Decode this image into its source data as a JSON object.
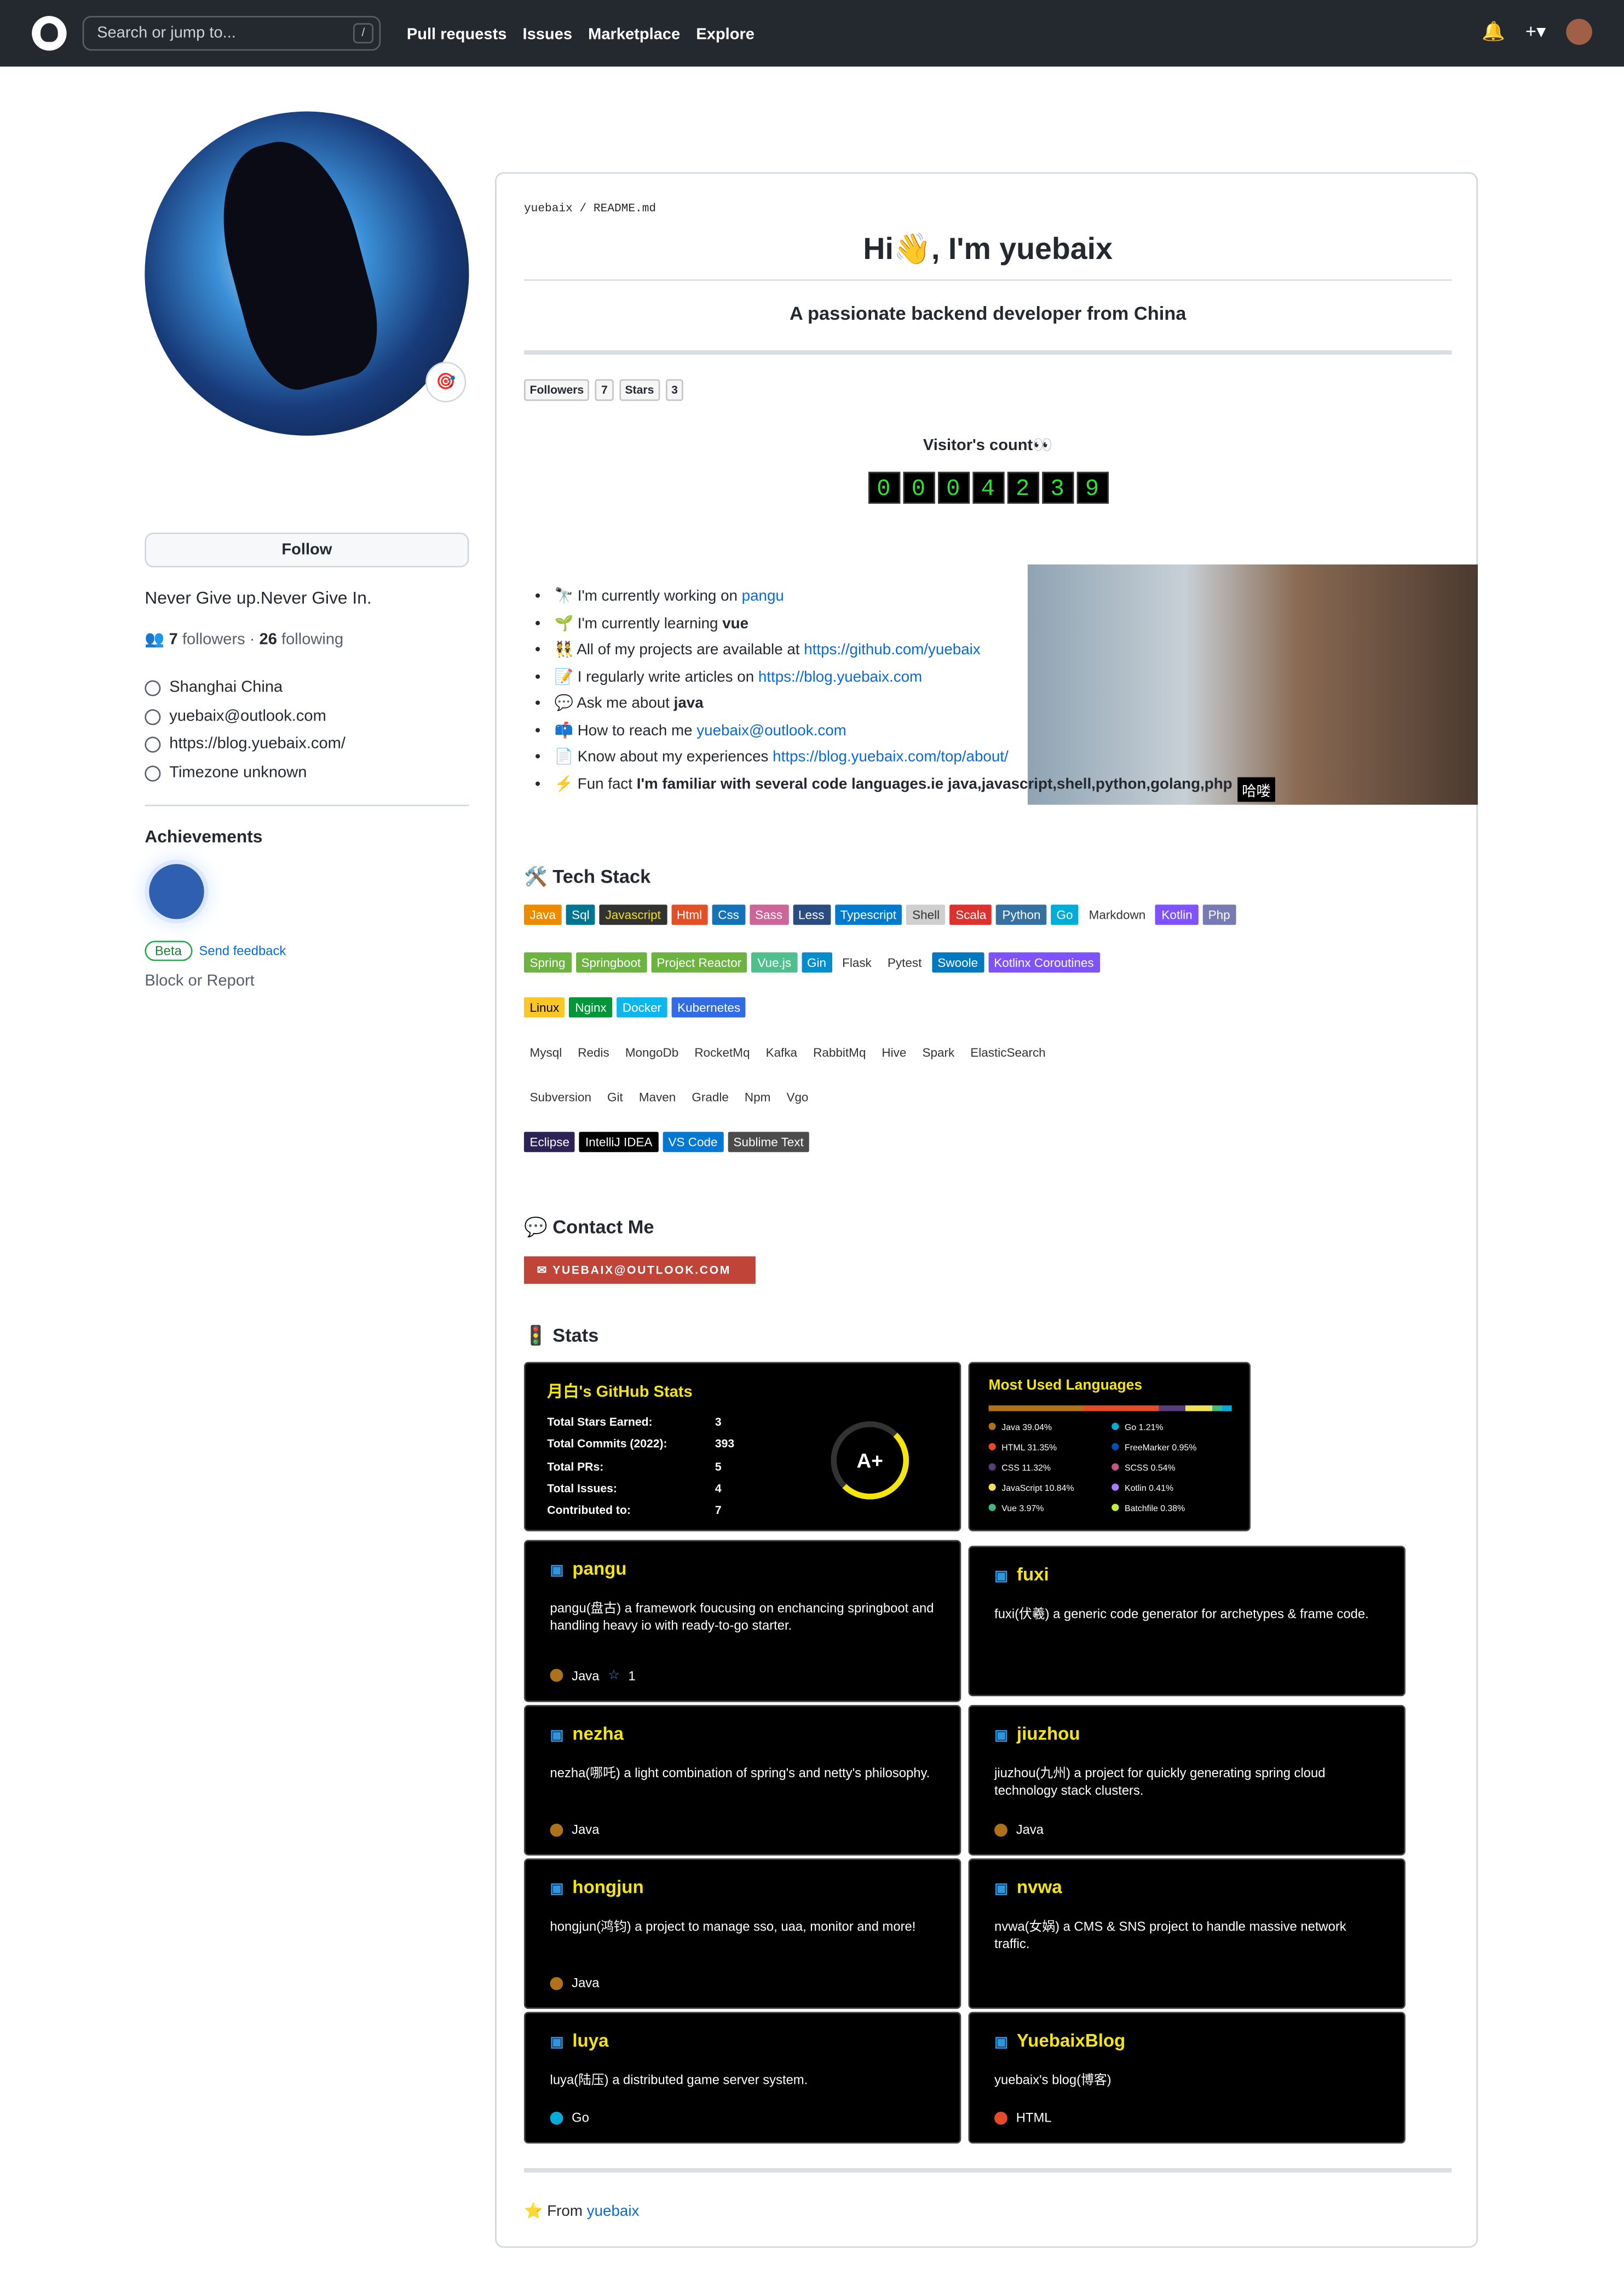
{
  "header": {
    "search_placeholder": "Search or jump to...",
    "slash": "/",
    "nav": [
      "Pull requests",
      "Issues",
      "Marketplace",
      "Explore"
    ]
  },
  "profile": {
    "follow": "Follow",
    "bio": "Never Give up.Never Give In.",
    "followers": "7",
    "followers_label": "followers",
    "following": "26",
    "following_label": "following",
    "location": "Shanghai China",
    "email": "yuebaix@outlook.com",
    "website": "https://blog.yuebaix.com/",
    "timezone": "Timezone unknown",
    "achievements": "Achievements",
    "beta": "Beta",
    "feedback": "Send feedback",
    "block": "Block or Report"
  },
  "readme": {
    "path_user": "yuebaix",
    "path_file": "README.md",
    "title": "Hi👋, I'm yuebaix",
    "subtitle": "A passionate backend developer from China",
    "followers": "Followers",
    "followers_count": "7",
    "stars": "Stars",
    "stars_count": "3",
    "visitor": "Visitor's count👀",
    "digits": [
      "0",
      "0",
      "0",
      "4",
      "2",
      "3",
      "9"
    ],
    "gif_caption": "哈喽",
    "facts": [
      {
        "pre": "🔭 I'm currently working on ",
        "link": "pangu"
      },
      {
        "pre": "🌱 I'm currently learning ",
        "bold": "vue"
      },
      {
        "pre": "👯 All of my projects are available at ",
        "link": "https://github.com/yuebaix"
      },
      {
        "pre": "📝 I regularly write articles on ",
        "link": "https://blog.yuebaix.com"
      },
      {
        "pre": "💬 Ask me about ",
        "bold": "java"
      },
      {
        "pre": "📫 How to reach me ",
        "link": "yuebaix@outlook.com"
      },
      {
        "pre": "📄 Know about my experiences ",
        "link": "https://blog.yuebaix.com/top/about/"
      },
      {
        "pre": "⚡ Fun fact ",
        "bold": "I'm familiar with several code languages.ie java,javascript,shell,python,golang,php"
      }
    ],
    "tech_title": "🛠️ Tech Stack",
    "rows": [
      [
        {
          "t": "Java",
          "c": "#ed8b00"
        },
        {
          "t": "Sql",
          "c": "#00758f"
        },
        {
          "t": "Javascript",
          "c": "#323330",
          "f": "#f7df1e"
        },
        {
          "t": "Html",
          "c": "#e34f26"
        },
        {
          "t": "Css",
          "c": "#1572b6"
        },
        {
          "t": "Sass",
          "c": "#cc6699"
        },
        {
          "t": "Less",
          "c": "#2b4c80"
        },
        {
          "t": "Typescript",
          "c": "#007acc"
        },
        {
          "t": "Shell",
          "c": "#cfcfcf",
          "f": "#333"
        },
        {
          "t": "Scala",
          "c": "#dc322f"
        },
        {
          "t": "Python",
          "c": "#3670a0"
        },
        {
          "t": "Go",
          "c": "#00add8"
        },
        {
          "t": "Markdown",
          "c": ""
        },
        {
          "t": "Kotlin",
          "c": "#7f52ff"
        },
        {
          "t": "Php",
          "c": "#777bb4"
        }
      ],
      [
        {
          "t": "Spring",
          "c": "#6db33f"
        },
        {
          "t": "Springboot",
          "c": "#6db33f"
        },
        {
          "t": "Project Reactor",
          "c": "#6db33f"
        },
        {
          "t": "Vue.js",
          "c": "#4fc08d"
        },
        {
          "t": "Gin",
          "c": "#008ecf"
        },
        {
          "t": "Flask",
          "c": ""
        },
        {
          "t": "Pytest",
          "c": ""
        },
        {
          "t": "Swoole",
          "c": "#0079c1"
        },
        {
          "t": "Kotlinx Coroutines",
          "c": "#7f52ff"
        }
      ],
      [
        {
          "t": "Linux",
          "c": "#fcc624",
          "f": "#000"
        },
        {
          "t": "Nginx",
          "c": "#009639"
        },
        {
          "t": "Docker",
          "c": "#0db7ed"
        },
        {
          "t": "Kubernetes",
          "c": "#326ce5"
        }
      ],
      [
        {
          "t": "Mysql",
          "c": ""
        },
        {
          "t": "Redis",
          "c": ""
        },
        {
          "t": "MongoDb",
          "c": ""
        },
        {
          "t": "RocketMq",
          "c": ""
        },
        {
          "t": "Kafka",
          "c": ""
        },
        {
          "t": "RabbitMq",
          "c": ""
        },
        {
          "t": "Hive",
          "c": ""
        },
        {
          "t": "Spark",
          "c": ""
        },
        {
          "t": "ElasticSearch",
          "c": ""
        }
      ],
      [
        {
          "t": "Subversion",
          "c": ""
        },
        {
          "t": "Git",
          "c": ""
        },
        {
          "t": "Maven",
          "c": ""
        },
        {
          "t": "Gradle",
          "c": ""
        },
        {
          "t": "Npm",
          "c": ""
        },
        {
          "t": "Vgo",
          "c": ""
        }
      ],
      [
        {
          "t": "Eclipse",
          "c": "#2c2255"
        },
        {
          "t": "IntelliJ IDEA",
          "c": "#000"
        },
        {
          "t": "VS Code",
          "c": "#0078d4"
        },
        {
          "t": "Sublime Text",
          "c": "#4c4c4c"
        }
      ]
    ],
    "contact_title": "💬 Contact Me",
    "mail_badge": "✉ YUEBAIX@OUTLOOK.COM",
    "stats_title": "🚦 Stats",
    "gh": {
      "title": "月白's GitHub Stats",
      "rows": [
        [
          "Total Stars Earned:",
          "3"
        ],
        [
          "Total Commits (2022):",
          "393"
        ],
        [
          "Total PRs:",
          "5"
        ],
        [
          "Total Issues:",
          "4"
        ],
        [
          "Contributed to:",
          "7"
        ]
      ],
      "grade": "A+"
    },
    "langs": {
      "title": "Most Used Languages",
      "items": [
        [
          "Java 39.04%",
          "#b07219"
        ],
        [
          "Go 1.21%",
          "#00add8"
        ],
        [
          "HTML 31.35%",
          "#e34c26"
        ],
        [
          "FreeMarker 0.95%",
          "#0050b2"
        ],
        [
          "CSS 11.32%",
          "#563d7c"
        ],
        [
          "SCSS 0.54%",
          "#c6538c"
        ],
        [
          "JavaScript 10.84%",
          "#f1e05a"
        ],
        [
          "Kotlin 0.41%",
          "#a97bff"
        ],
        [
          "Vue 3.97%",
          "#41b883"
        ],
        [
          "Batchfile 0.38%",
          "#c1f12e"
        ]
      ]
    },
    "repos": [
      {
        "n": "pangu",
        "d": "pangu(盘古) a framework foucusing on enchancing springboot and handling heavy io with ready-to-go starter.",
        "l": "Java",
        "c": "#b07219",
        "s": "1"
      },
      {
        "n": "fuxi",
        "d": "fuxi(伏羲) a generic code generator for archetypes & frame code.",
        "l": "",
        "c": ""
      },
      {
        "n": "nezha",
        "d": "nezha(哪吒) a light combination of spring's and netty's philosophy.",
        "l": "Java",
        "c": "#b07219"
      },
      {
        "n": "jiuzhou",
        "d": "jiuzhou(九州) a project for quickly generating spring cloud technology stack clusters.",
        "l": "Java",
        "c": "#b07219"
      },
      {
        "n": "hongjun",
        "d": "hongjun(鸿钧) a project to manage sso, uaa, monitor and more!",
        "l": "Java",
        "c": "#b07219"
      },
      {
        "n": "nvwa",
        "d": "nvwa(女娲) a CMS & SNS project to handle massive network traffic.",
        "l": "",
        "c": ""
      },
      {
        "n": "luya",
        "d": "luya(陆压) a distributed game server system.",
        "l": "Go",
        "c": "#00add8"
      },
      {
        "n": "YuebaixBlog",
        "d": "yuebaix's blog(博客)",
        "l": "HTML",
        "c": "#e34c26"
      }
    ],
    "footer_pre": "⭐ From ",
    "footer_link": "yuebaix"
  }
}
